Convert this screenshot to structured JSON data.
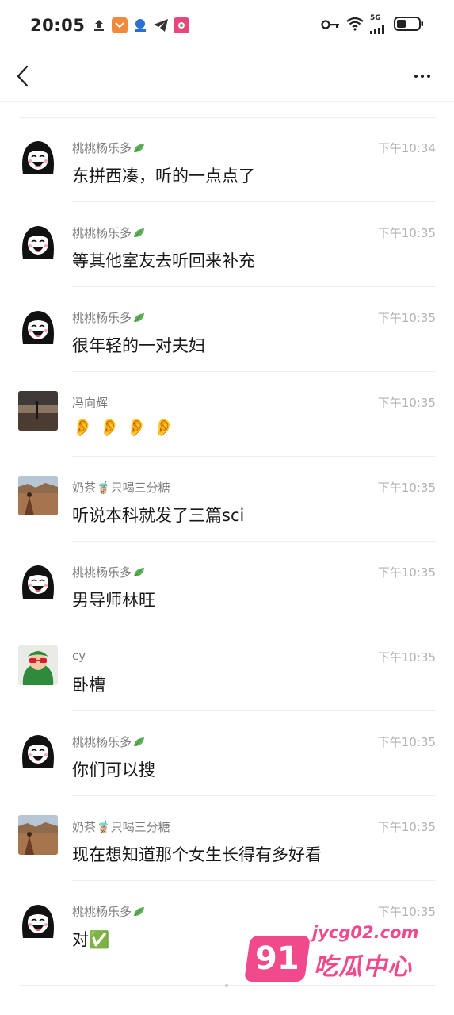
{
  "status_bar": {
    "time": "20:05",
    "network": "5G",
    "icons": [
      "upload-icon",
      "shield-app-icon",
      "pay-app-icon",
      "telegram-icon",
      "game-app-icon",
      "key-icon",
      "wifi-icon",
      "signal-icon",
      "battery-icon"
    ]
  },
  "nav": {
    "back_icon": "chevron-left-icon",
    "more_icon": "more-dots-icon"
  },
  "messages": [
    {
      "name": "桃桃杨乐多",
      "leaf": true,
      "time": "下午10:34",
      "text": "东拼西凑，听的一点点了",
      "avatar": "girl-cartoon"
    },
    {
      "name": "桃桃杨乐多",
      "leaf": true,
      "time": "下午10:35",
      "text": "等其他室友去听回来补充",
      "avatar": "girl-cartoon"
    },
    {
      "name": "桃桃杨乐多",
      "leaf": true,
      "time": "下午10:35",
      "text": "很年轻的一对夫妇",
      "avatar": "girl-cartoon"
    },
    {
      "name": "冯向辉",
      "leaf": false,
      "time": "下午10:35",
      "text": "",
      "emoji": [
        "👂",
        "👂",
        "👂",
        "👂"
      ],
      "avatar": "beach-photo"
    },
    {
      "name": "奶茶🧋只喝三分糖",
      "leaf": false,
      "time": "下午10:35",
      "text": "听说本科就发了三篇sci",
      "avatar": "desert-photo"
    },
    {
      "name": "桃桃杨乐多",
      "leaf": true,
      "time": "下午10:35",
      "text": "男导师林旺",
      "avatar": "girl-cartoon"
    },
    {
      "name": "cy",
      "leaf": false,
      "time": "下午10:35",
      "text": "卧槽",
      "avatar": "child-green-photo"
    },
    {
      "name": "桃桃杨乐多",
      "leaf": true,
      "time": "下午10:35",
      "text": "你们可以搜",
      "avatar": "girl-cartoon"
    },
    {
      "name": "奶茶🧋只喝三分糖",
      "leaf": false,
      "time": "下午10:35",
      "text": "现在想知道那个女生长得有多好看",
      "avatar": "desert-photo"
    },
    {
      "name": "桃桃杨乐多",
      "leaf": true,
      "time": "下午10:35",
      "text": "对✅",
      "avatar": "girl-cartoon"
    }
  ],
  "watermark": {
    "badge": "91",
    "url": "jycg02.com",
    "title": "吃瓜中心",
    "color": "#f04a8c"
  }
}
